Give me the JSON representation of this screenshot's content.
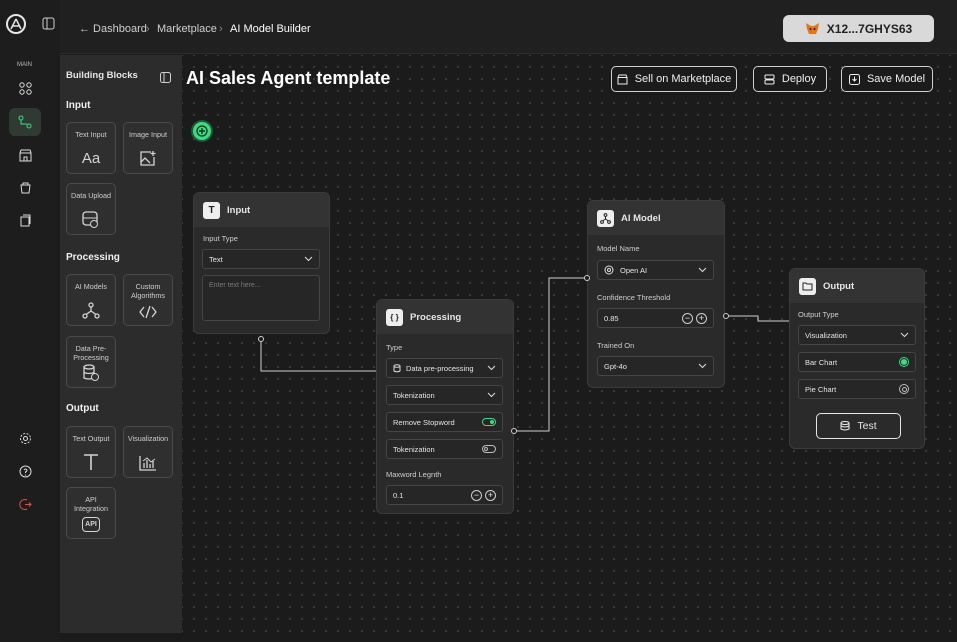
{
  "nav": {
    "main_label": "MAIN"
  },
  "breadcrumb": {
    "back": "← Dashboard",
    "sep": "›",
    "marketplace": "Marketplace",
    "current": "AI Model Builder"
  },
  "wallet": {
    "address": "X12...7GHYS63"
  },
  "panel": {
    "title": "Building Blocks",
    "input_title": "Input",
    "text_input": "Text Input",
    "image_input": "Image Input",
    "data_upload": "Data Upload",
    "processing_title": "Processing",
    "ai_models": "AI Models",
    "custom_algorithms": "Custom Algorithms",
    "data_pre_processing": "Data Pre-Processing",
    "output_title": "Output",
    "text_output": "Text Output",
    "visualization": "Visualization",
    "api_integration": "API Integration"
  },
  "page": {
    "title": "AI Sales Agent template"
  },
  "toolbar": {
    "sell": "Sell on Marketplace",
    "deploy": "Deploy",
    "save": "Save Model"
  },
  "input_node": {
    "title": "Input",
    "type_label": "Input Type",
    "type_value": "Text",
    "placeholder": "Enter text here..."
  },
  "processing_node": {
    "title": "Processing",
    "type_label": "Type",
    "type_value": "Data pre-processing",
    "tokenization_select": "Tokenization",
    "remove_stopword": "Remove Stopword",
    "tokenization_toggle": "Tokenization",
    "maxword_label": "Maxword Legnth",
    "maxword_value": "0.1"
  },
  "ai_model_node": {
    "title": "AI Model",
    "model_label": "Model Name",
    "model_value": "Open AI",
    "confidence_label": "Confidence Threshold",
    "confidence_value": "0.85",
    "trained_label": "Trained On",
    "trained_value": "Gpt-4o"
  },
  "output_node": {
    "title": "Output",
    "type_label": "Output Type",
    "type_value": "Visualization",
    "bar_chart": "Bar Chart",
    "pie_chart": "Pie Chart",
    "test_button": "Test"
  },
  "colors": {
    "accent_green": "#3ddc84",
    "bg": "#1b1b1b",
    "panel": "#2c2c2c",
    "wallet_bg": "#d9d9d9"
  }
}
